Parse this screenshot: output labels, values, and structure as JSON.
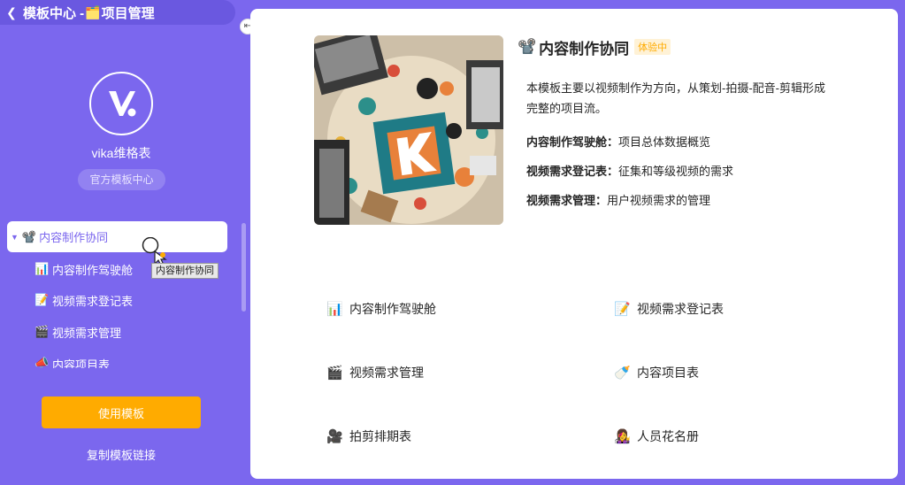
{
  "header": {
    "back_icon": "chevron-left-icon",
    "title_prefix": "模板中心 - ",
    "folder_emoji": "🗂️",
    "title_suffix": "项目管理"
  },
  "sidebar": {
    "brand_name": "vika维格表",
    "official_badge": "官方模板中心",
    "tree_root": {
      "emoji": "📽️",
      "label": "内容制作协同"
    },
    "tree_items": [
      {
        "emoji": "📊",
        "label": "内容制作驾驶舱"
      },
      {
        "emoji": "📝",
        "label": "视频需求登记表"
      },
      {
        "emoji": "🎬",
        "label": "视频需求管理"
      },
      {
        "emoji": "📣",
        "label": "内容项目表"
      }
    ],
    "use_button": "使用模板",
    "copy_link": "复制模板链接",
    "tooltip": "内容制作协同"
  },
  "detail": {
    "title_emoji": "📽️",
    "title": "内容制作协同",
    "badge": "体验中",
    "description": "本模板主要以视频制作为方向，从策划-拍摄-配音-剪辑形成完整的项目流。",
    "features": [
      {
        "name": "内容制作驾驶舱：",
        "desc": "项目总体数据概览"
      },
      {
        "name": "视频需求登记表：",
        "desc": "征集和等级视频的需求"
      },
      {
        "name": "视频需求管理：",
        "desc": "用户视频需求的管理"
      }
    ],
    "tables": [
      {
        "emoji": "📊",
        "label": "内容制作驾驶舱"
      },
      {
        "emoji": "📝",
        "label": "视频需求登记表"
      },
      {
        "emoji": "🎬",
        "label": "视频需求管理"
      },
      {
        "emoji": "🍼",
        "label": "内容项目表"
      },
      {
        "emoji": "🎥",
        "label": "拍剪排期表"
      },
      {
        "emoji": "👩‍🎤",
        "label": "人员花名册"
      }
    ]
  },
  "colors": {
    "brand_purple": "#7b67ee",
    "accent_orange": "#ffab00",
    "badge_bg": "#fff2d6"
  }
}
